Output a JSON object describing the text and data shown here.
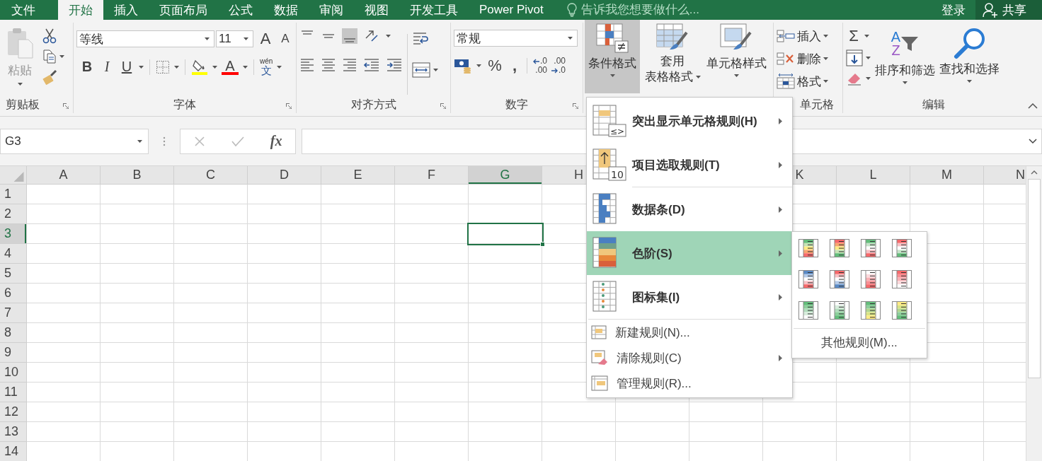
{
  "tabs": [
    {
      "label": "文件",
      "selected": false
    },
    {
      "label": "开始",
      "selected": true
    },
    {
      "label": "插入",
      "selected": false
    },
    {
      "label": "页面布局",
      "selected": false
    },
    {
      "label": "公式",
      "selected": false
    },
    {
      "label": "数据",
      "selected": false
    },
    {
      "label": "审阅",
      "selected": false
    },
    {
      "label": "视图",
      "selected": false
    },
    {
      "label": "开发工具",
      "selected": false
    },
    {
      "label": "Power Pivot",
      "selected": false
    }
  ],
  "tell_me": {
    "placeholder": "告诉我您想要做什么..."
  },
  "sign_in": "登录",
  "share": "共享",
  "ribbon": {
    "clipboard": {
      "paste": "粘贴",
      "label": "剪贴板"
    },
    "font": {
      "font_name": "等线",
      "font_size": "11",
      "grow": "A",
      "shrink": "A",
      "bold": "B",
      "italic": "I",
      "underline": "U",
      "font_color": "A",
      "phonetic_top": "wén",
      "phonetic_bottom": "文",
      "label": "字体"
    },
    "alignment": {
      "label": "对齐方式"
    },
    "number": {
      "format": "常规",
      "percent": "%",
      "comma": ",",
      "decimal_increase": [
        ".0",
        ".00"
      ],
      "decimal_decrease": [
        ".00",
        ".0"
      ],
      "label": "数字"
    },
    "styles": {
      "conditional_formatting": {
        "label": "条件格式",
        "expanded": true
      },
      "format_as_table": [
        "套用",
        "表格格式"
      ],
      "cell_styles": "单元格样式"
    },
    "cells": {
      "insert": "插入",
      "delete": "删除",
      "format": "格式",
      "label": "单元格"
    },
    "editing": {
      "autosum": "Σ",
      "sort_letters": [
        "A",
        "Z"
      ],
      "sort_filter": "排序和筛选",
      "find_select": "查找和选择",
      "label": "编辑"
    }
  },
  "formula_bar": {
    "name_box": "G3",
    "function": "fx"
  },
  "sheet": {
    "columns": [
      {
        "label": "A",
        "selected": false
      },
      {
        "label": "B",
        "selected": false
      },
      {
        "label": "C",
        "selected": false
      },
      {
        "label": "D",
        "selected": false
      },
      {
        "label": "E",
        "selected": false
      },
      {
        "label": "F",
        "selected": false
      },
      {
        "label": "G",
        "selected": true
      },
      {
        "label": "H",
        "selected": false
      },
      {},
      {},
      {
        "label": "K",
        "selected": false
      },
      {
        "label": "L",
        "selected": false
      },
      {
        "label": "M",
        "selected": false
      },
      {
        "label": "N",
        "selected": false
      }
    ],
    "rows": [
      {
        "label": "1",
        "selected": false
      },
      {
        "label": "2",
        "selected": false
      },
      {
        "label": "3",
        "selected": true
      },
      {
        "label": "4",
        "selected": false
      },
      {
        "label": "5",
        "selected": false
      },
      {
        "label": "6",
        "selected": false
      },
      {
        "label": "7",
        "selected": false
      },
      {
        "label": "8",
        "selected": false
      },
      {
        "label": "9",
        "selected": false
      },
      {
        "label": "10",
        "selected": false
      },
      {
        "label": "11",
        "selected": false
      },
      {
        "label": "12",
        "selected": false
      },
      {
        "label": "13",
        "selected": false
      },
      {
        "label": "14",
        "selected": false
      }
    ]
  },
  "menu": {
    "items": [
      {
        "kind": "large",
        "label": "突出显示单元格规则(H)",
        "submenu": true,
        "selected": false,
        "icon_text": "≤>"
      },
      {
        "kind": "large",
        "label": "项目选取规则(T)",
        "submenu": true,
        "selected": false,
        "icon_text": "10"
      },
      {
        "kind": "large",
        "label": "数据条(D)",
        "submenu": true,
        "selected": false
      },
      {
        "kind": "large",
        "label": "色阶(S)",
        "submenu": true,
        "selected": true
      },
      {
        "kind": "large",
        "label": "图标集(I)",
        "submenu": true,
        "selected": false
      },
      {
        "kind": "small",
        "label": "新建规则(N)...",
        "submenu": false,
        "selected": false
      },
      {
        "kind": "small",
        "label": "清除规则(C)",
        "submenu": true,
        "selected": false
      },
      {
        "kind": "small",
        "label": "管理规则(R)...",
        "submenu": false,
        "selected": false
      }
    ],
    "submenu": {
      "more": "其他规则(M)..."
    }
  }
}
